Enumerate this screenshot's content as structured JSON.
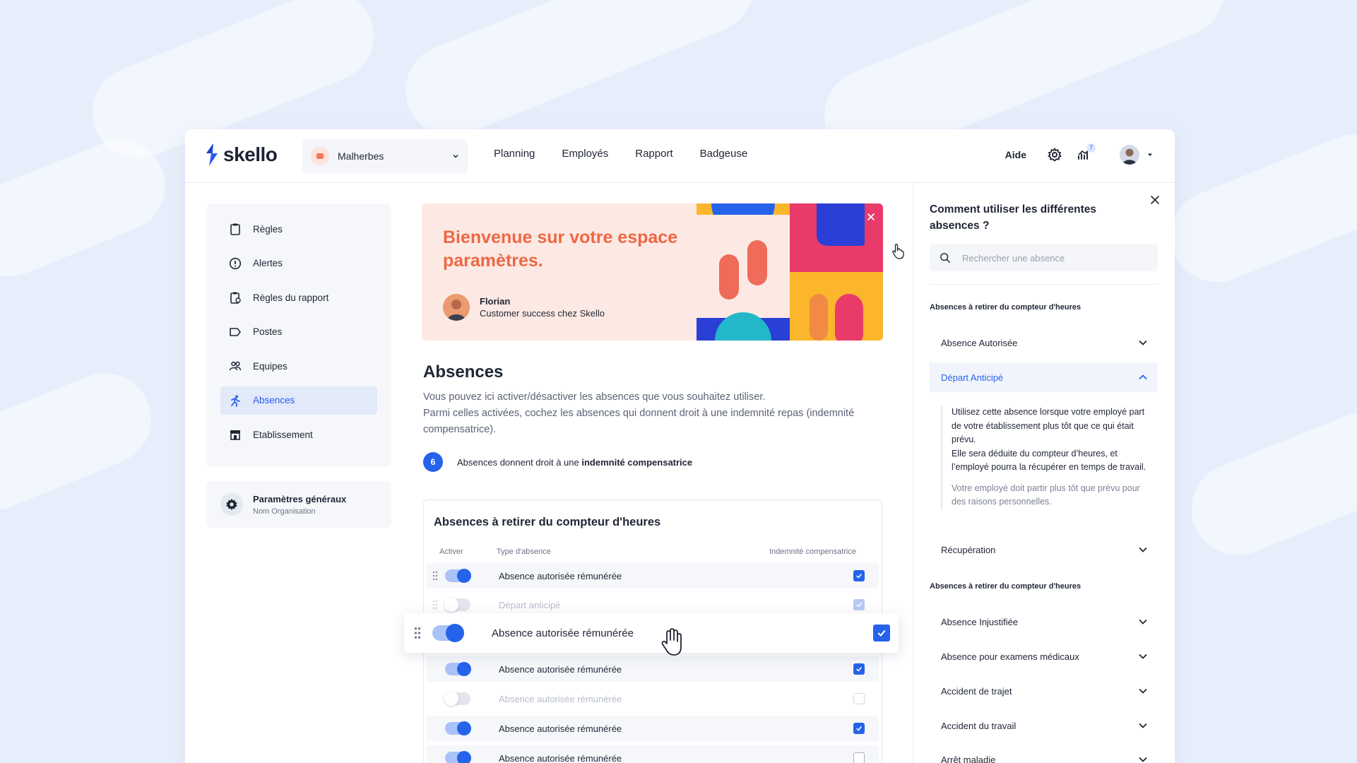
{
  "header": {
    "logo_text": "skello",
    "shop": "Malherbes",
    "nav": [
      "Planning",
      "Employés",
      "Rapport",
      "Badgeuse"
    ],
    "help": "Aide",
    "notif_count": "7"
  },
  "sidebar": {
    "items": [
      {
        "label": "Règles",
        "icon": "clipboard-icon"
      },
      {
        "label": "Alertes",
        "icon": "alert-circle-icon"
      },
      {
        "label": "Règles du rapport",
        "icon": "report-rules-icon"
      },
      {
        "label": "Postes",
        "icon": "tag-icon"
      },
      {
        "label": "Equipes",
        "icon": "team-icon"
      },
      {
        "label": "Absences",
        "icon": "absence-icon"
      },
      {
        "label": "Etablissement",
        "icon": "store-icon"
      }
    ],
    "active": "Absences",
    "general_title": "Paramètres généraux",
    "general_sub": "Nom Organisation"
  },
  "banner": {
    "title": "Bienvenue sur votre espace paramètres.",
    "person_name": "Florian",
    "person_role": "Customer success chez Skello"
  },
  "main": {
    "title": "Absences",
    "desc": "Vous pouvez ici activer/désactiver les absences que vous souhaitez utiliser.\nParmi celles activées, cochez les absences qui donnent droit à une indemnité repas (indemnité compensatrice).",
    "count": "6",
    "count_text": "Absences donnent droit à une ",
    "count_strong": "indemnité compensatrice"
  },
  "card": {
    "title": "Absences à retirer du compteur d'heures",
    "col_activate": "Activer",
    "col_type": "Type d'absence",
    "col_comp": "Indemnité compensatrice",
    "rows": [
      {
        "label": "Absence autorisée rémunérée",
        "active": true,
        "checked": true
      },
      {
        "label": "Départ anticipé",
        "active": false,
        "checked": true
      },
      {
        "label": "Absence autorisée rémunérée",
        "active": true,
        "checked": true
      },
      {
        "label": "Absence autorisée rémunérée",
        "active": false,
        "checked": false
      },
      {
        "label": "Absence autorisée rémunérée",
        "active": true,
        "checked": true
      },
      {
        "label": "Absence autorisée rémunérée",
        "active": true,
        "checked": false
      }
    ],
    "dragged": {
      "label": "Absence autorisée rémunérée",
      "active": true,
      "checked": true
    }
  },
  "panel": {
    "title": "Comment utiliser les différentes absences ?",
    "search_placeholder": "Rechercher une absence",
    "section1": "Absences à retirer du compteur d'heures",
    "section2": "Absences à retirer du compteur d'heures",
    "acc1": [
      "Absence Autorisée",
      "Départ Anticipé",
      "Récupération"
    ],
    "acc2": [
      "Absence Injustifiée",
      "Absence pour examens médicaux",
      "Accident de trajet",
      "Accident du travail",
      "Arrêt maladie"
    ],
    "open_body": "Utilisez cette absence lorsque votre employé part de votre établissement plus tôt que ce qui était prévu.\nElle sera déduite du compteur d’heures, et l’employé pourra la récupérer en temps de travail.",
    "open_example": "Votre employé doit partir plus tôt que prévu pour des raisons personnelles."
  },
  "colors": {
    "accent": "#2563eb",
    "banner_bg": "#fde9e3",
    "banner_title": "#ee6744"
  }
}
